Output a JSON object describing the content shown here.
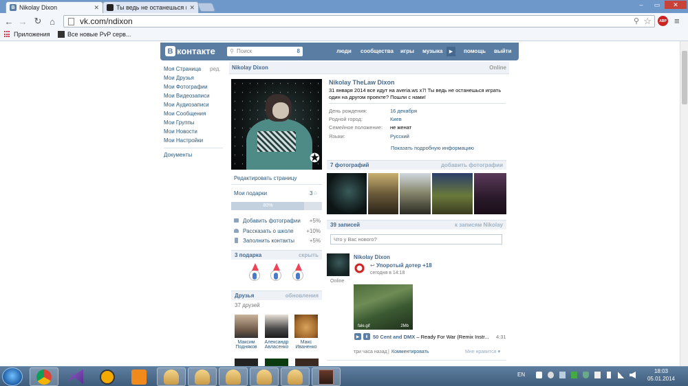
{
  "browser": {
    "tabs": [
      {
        "label": "Nikolay Dixon",
        "active": true
      },
      {
        "label": "Ты ведь не останешься и",
        "active": false
      }
    ],
    "url": "vk.com/ndixon",
    "bookmarks": {
      "apps": "Приложения",
      "item1": "Все новые PvP серв..."
    }
  },
  "vk": {
    "logo_text": "контакте",
    "search": {
      "placeholder": "Поиск",
      "badge": "8"
    },
    "nav": [
      "люди",
      "сообщества",
      "игры",
      "музыка",
      "помощь",
      "выйти"
    ]
  },
  "left_menu": {
    "items": [
      "Моя Страница",
      "Мои Друзья",
      "Мои Фотографии",
      "Мои Видеозаписи",
      "Мои Аудиозаписи",
      "Мои Сообщения",
      "Мои Группы",
      "Мои Новости",
      "Мои Настройки"
    ],
    "edit": "ред.",
    "documents": "Документы"
  },
  "profile": {
    "name_bar": "Nikolay Dixon",
    "online": "Online",
    "edit_page": "Редактировать страницу",
    "my_gifts": "Мои подарки",
    "gifts_count": "3",
    "progress": {
      "label": "80%",
      "value": 0.8
    },
    "tasks": [
      {
        "label": "Добавить фотографии",
        "bonus": "+5%"
      },
      {
        "label": "Рассказать о школе",
        "bonus": "+10%"
      },
      {
        "label": "Заполнить контакты",
        "bonus": "+5%"
      }
    ],
    "gifts_section": {
      "title": "3 подарка",
      "hide": "скрыть"
    },
    "friends_section": {
      "title": "Друзья",
      "updates": "обновления",
      "count": "37 друзей"
    },
    "friends": [
      {
        "first": "Максим",
        "last": "Подняков"
      },
      {
        "first": "Александр",
        "last": "Авласенко"
      },
      {
        "first": "Макс",
        "last": "Иваненко"
      }
    ]
  },
  "info": {
    "full_name": "Nikolay TheLaw Dixon",
    "status": "31 января 2014 все идут на averia.ws x7! Ты ведь не останешься играть один на другом проекте? Пошли с нами!",
    "rows": [
      {
        "key": "День рождения:",
        "value": "16 декабря"
      },
      {
        "key": "Родной город:",
        "value": "Киев"
      },
      {
        "key": "Семейное положение:",
        "value": "не женат"
      },
      {
        "key": "Языки:",
        "value": "Русский"
      }
    ],
    "show_more": "Показать подробную информацию"
  },
  "photos_section": {
    "title": "7 фотографий",
    "add": "добавить фотографии"
  },
  "wall": {
    "title": "39 записей",
    "to_posts": "к записям Nikolay",
    "input_placeholder": "Что у Вас нового?",
    "post": {
      "author": "Nikolay Dixon",
      "online": "Online",
      "repost_group": "Упоротый дотер +18",
      "repost_time": "сегодня в 14:18",
      "video_label": "fale.gif",
      "video_size": "2Mb",
      "audio_artist": "50 Cent and DMX",
      "audio_title": "Ready For War (Remix Instr...",
      "audio_duration": "4:31",
      "time": "три часа назад",
      "comment": "Комментировать",
      "like": "Мне нравится"
    }
  },
  "taskbar": {
    "lang": "EN",
    "time": "18:03",
    "date": "05.01.2014"
  },
  "colors": {
    "vk_blue": "#597da3",
    "link": "#2b587a",
    "taskbar": "#4b6a8c"
  }
}
